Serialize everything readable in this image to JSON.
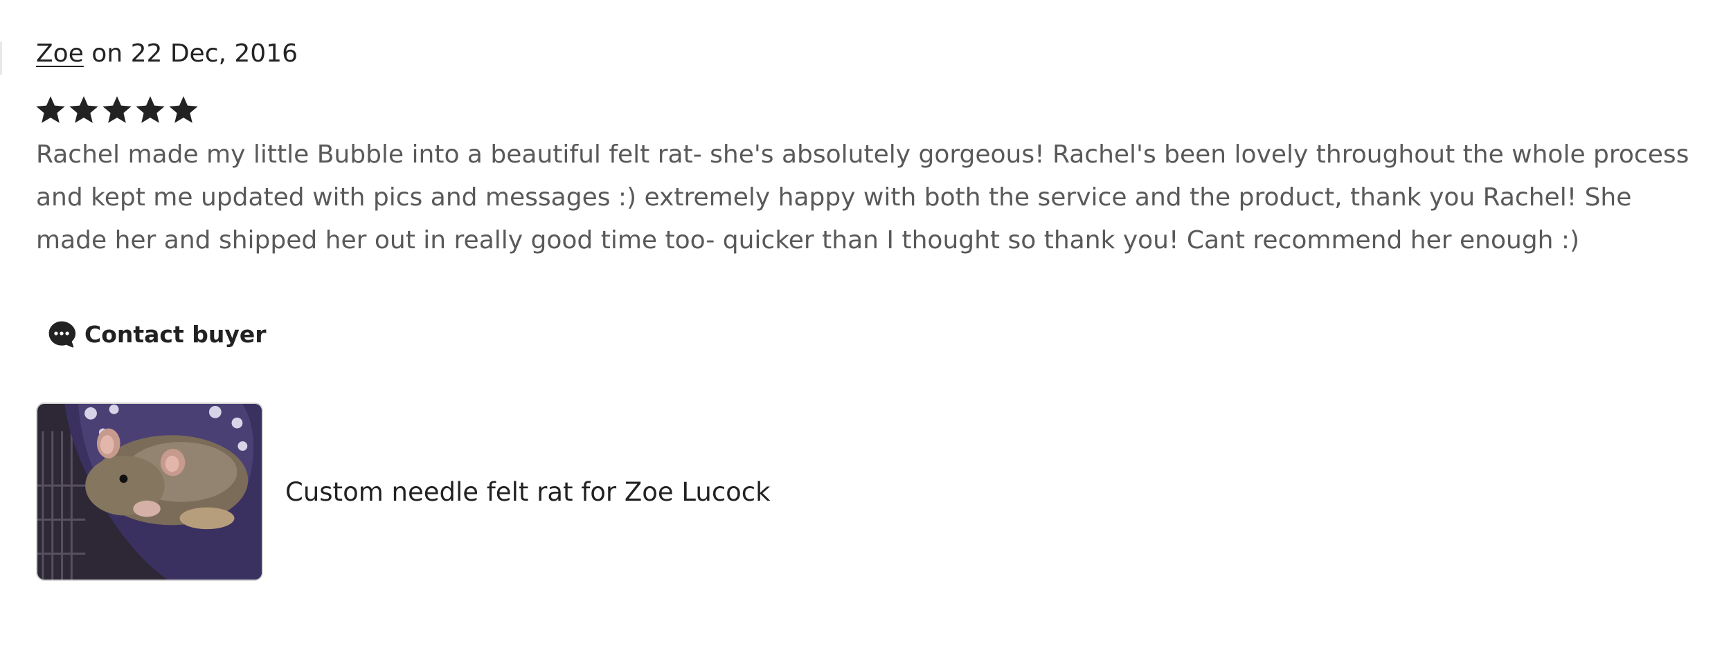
{
  "review": {
    "reviewer_name": "Zoe",
    "date_text": " on 22 Dec, 2016",
    "rating": 5,
    "rating_max": 5,
    "star_color": "#222222",
    "text": "Rachel made my little Bubble into a beautiful felt rat- she's absolutely gorgeous! Rachel's been lovely throughout the whole process and kept me updated with pics and messages :) extremely happy with both the service and the product, thank you Rachel! She made her and shipped her out in really good time too- quicker than I thought so thank you! Cant recommend her enough :)",
    "contact_button": {
      "label": "Contact buyer",
      "icon": "chat-bubble-icon"
    },
    "listing": {
      "title": "Custom needle felt rat for Zoe Lucock",
      "thumbnail_icon": "rat-photo-thumbnail"
    }
  }
}
